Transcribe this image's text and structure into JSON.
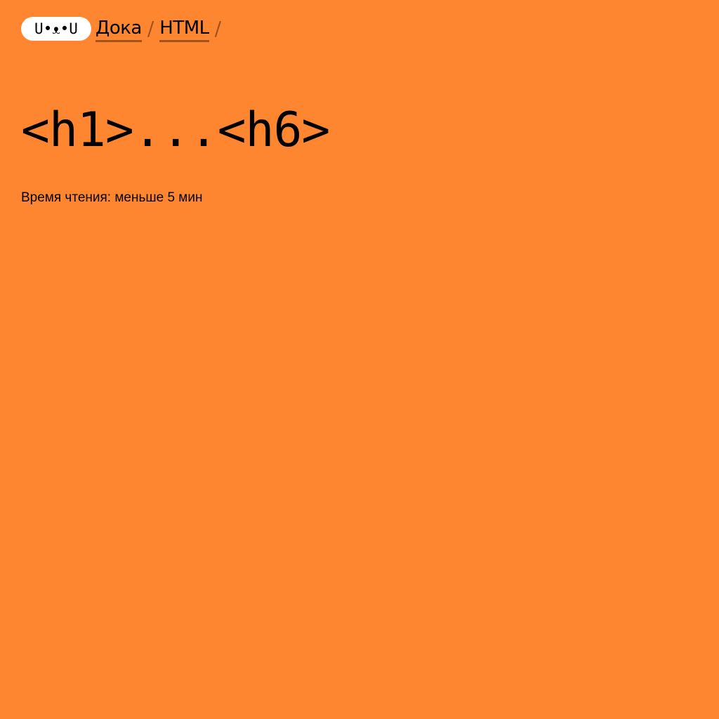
{
  "header": {
    "logo_text": "U•ᴥ•U",
    "breadcrumbs": [
      {
        "label": "Дока"
      },
      {
        "label": "HTML"
      }
    ],
    "separator": "/"
  },
  "main": {
    "title": "<h1>...<h6>",
    "reading_time": "Время чтения: меньше 5 мин"
  },
  "colors": {
    "background": "#ff8630",
    "logo_bg": "#ffffff",
    "accent_underline": "#a1531c",
    "text": "#000000"
  }
}
